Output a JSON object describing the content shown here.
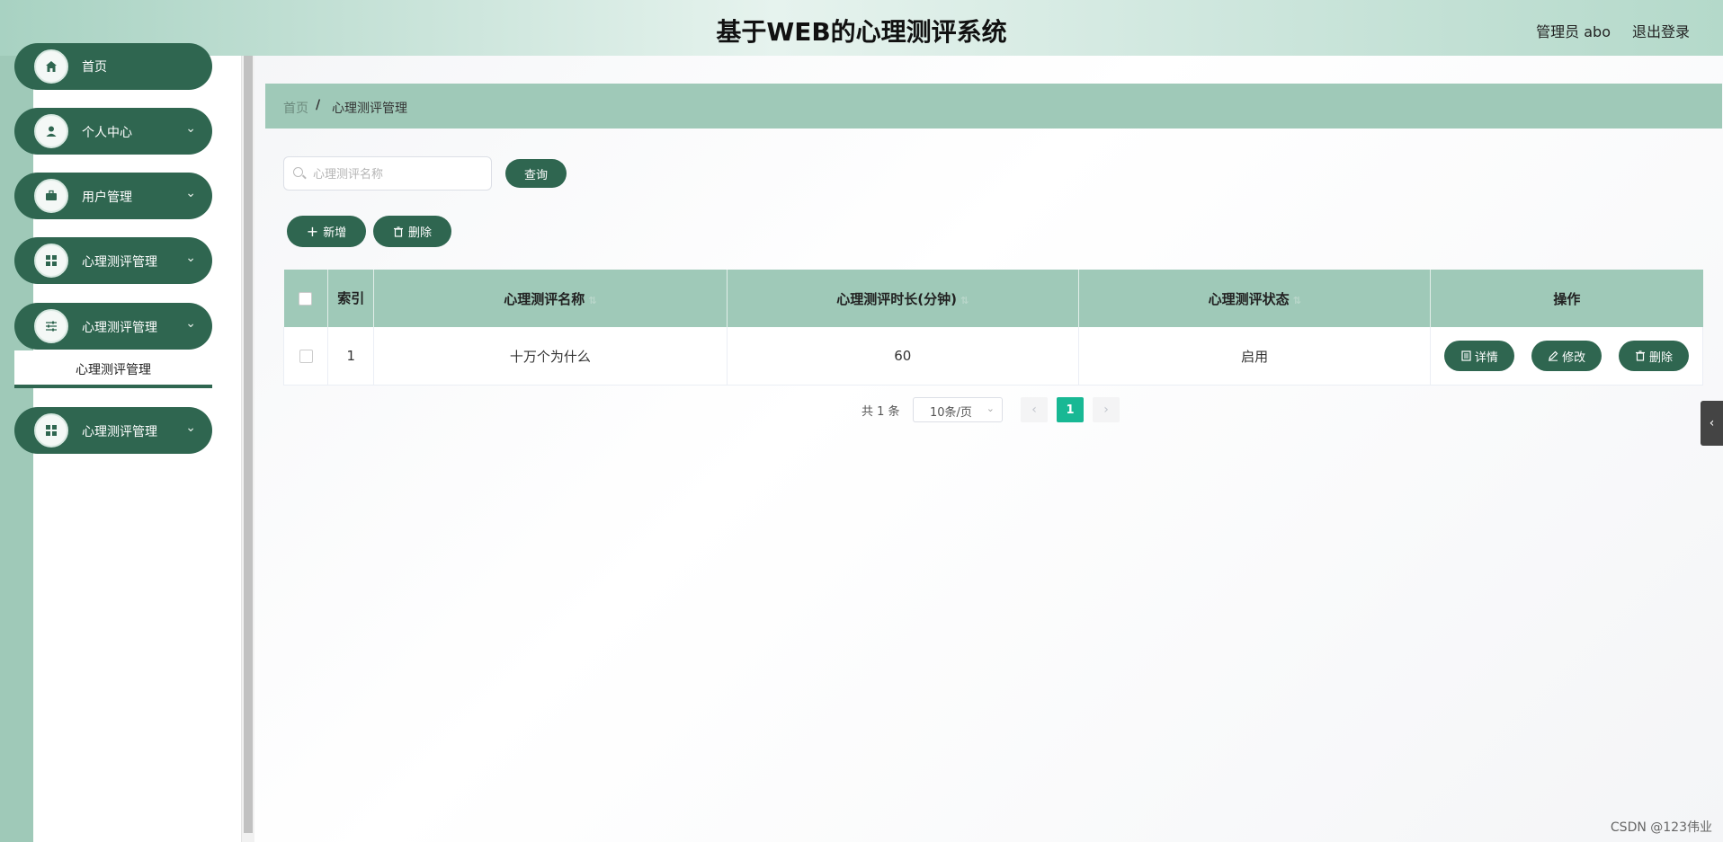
{
  "header": {
    "title": "基于WEB的心理测评系统",
    "user": "管理员 abo",
    "logout": "退出登录"
  },
  "sidebar": {
    "items": [
      {
        "label": "首页",
        "icon": "home-icon",
        "has_arrow": false
      },
      {
        "label": "个人中心",
        "icon": "user-icon",
        "has_arrow": true
      },
      {
        "label": "用户管理",
        "icon": "briefcase-icon",
        "has_arrow": true
      },
      {
        "label": "心理测评管理",
        "icon": "grid-icon",
        "has_arrow": true
      },
      {
        "label": "心理测评管理",
        "icon": "sliders-icon",
        "has_arrow": true
      },
      {
        "label": "心理测评管理",
        "icon": "grid-icon",
        "has_arrow": true
      }
    ],
    "submenu_label": "心理测评管理"
  },
  "breadcrumb": {
    "home": "首页",
    "separator": "/",
    "current": "心理测评管理"
  },
  "search": {
    "placeholder": "心理测评名称",
    "value": "",
    "button": "查询"
  },
  "toolbar": {
    "add": "新增",
    "delete": "删除"
  },
  "table": {
    "headers": [
      "索引",
      "心理测评名称",
      "心理测评时长(分钟)",
      "心理测评状态",
      "操作"
    ],
    "rows": [
      {
        "index": "1",
        "name": "十万个为什么",
        "duration": "60",
        "status": "启用"
      }
    ],
    "actions": {
      "detail": "详情",
      "edit": "修改",
      "delete": "删除"
    }
  },
  "pagination": {
    "total": "共 1 条",
    "page_size": "10条/页",
    "current_page": "1"
  },
  "watermark": "CSDN @123伟业",
  "colors": {
    "primary": "#2f6650",
    "header_bg": "#9fc9b8",
    "active_page": "#18b894"
  }
}
